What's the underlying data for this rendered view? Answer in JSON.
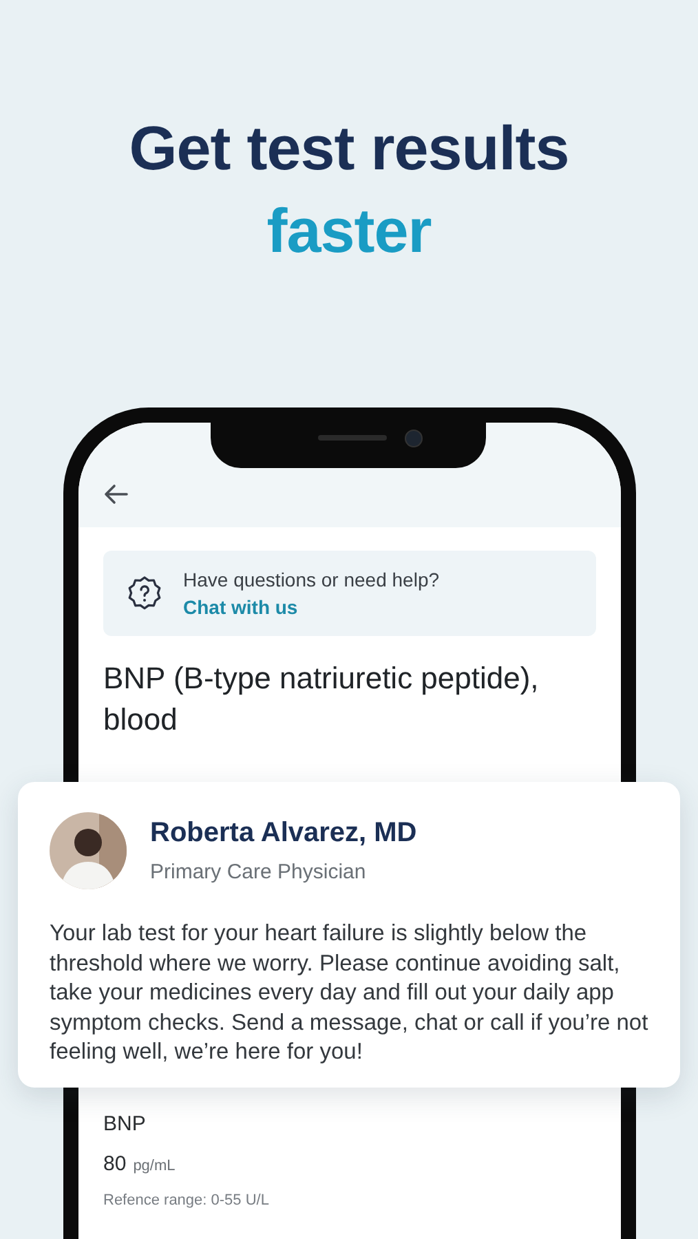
{
  "headline": {
    "line_1": "Get test results",
    "line_2": "faster"
  },
  "screen": {
    "help": {
      "question": "Have questions or need help?",
      "link": "Chat with us"
    },
    "title": "BNP (B-type natriuretic peptide), blood",
    "result": {
      "name": "BNP",
      "value": "80",
      "unit": "pg/mL",
      "reference": "Refence range: 0-55 U/L"
    }
  },
  "message": {
    "author": "Roberta Alvarez, MD",
    "role": "Primary Care Physician",
    "text": "Your lab test for your heart failure is slightly below the threshold where we worry. Please continue avoiding salt, take your medicines every day and fill out your daily app symptom checks. Send a message, chat or call if you’re not feeling well, we’re here for you!"
  }
}
